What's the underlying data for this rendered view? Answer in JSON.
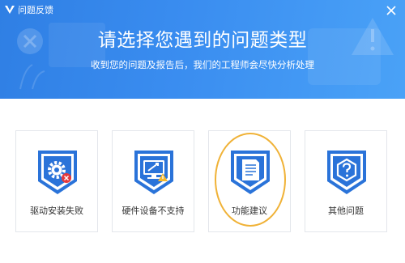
{
  "window": {
    "title": "问题反馈"
  },
  "header": {
    "headline": "请选择您遇到的问题类型",
    "subline": "收到您的问题及报告后，我们的工程师会尽快分析处理"
  },
  "cards": [
    {
      "label": "驱动安装失败",
      "icon": "gear-error-icon"
    },
    {
      "label": "硬件设备不支持",
      "icon": "monitor-warning-icon"
    },
    {
      "label": "功能建议",
      "icon": "document-icon"
    },
    {
      "label": "其他问题",
      "icon": "question-icon"
    }
  ],
  "colors": {
    "banner": "#3a8df0",
    "shield": "#2a73d9",
    "highlight": "#f0b237"
  }
}
